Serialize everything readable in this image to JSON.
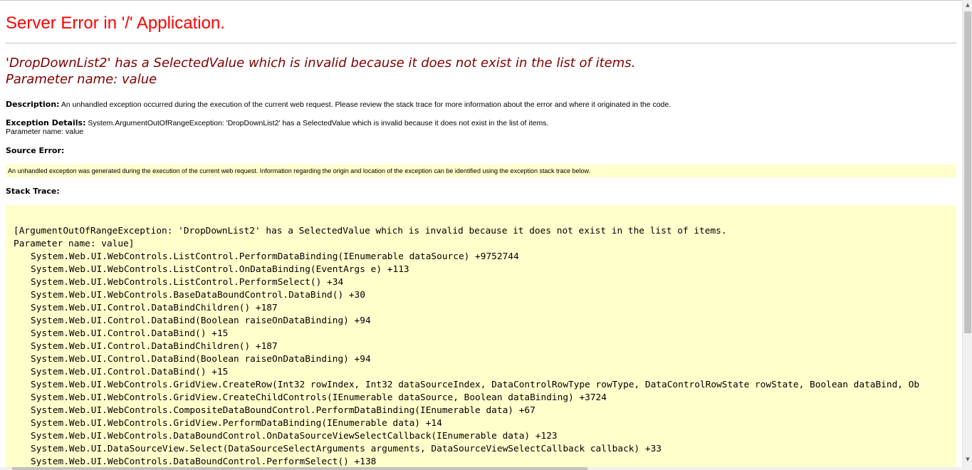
{
  "page": {
    "title": "Server Error in '/' Application.",
    "headline": [
      "'DropDownList2' has a SelectedValue which is invalid because it does not exist in the list of items.",
      "Parameter name: value"
    ],
    "description": {
      "label": "Description:",
      "text": "An unhandled exception occurred during the execution of the current web request. Please review the stack trace for more information about the error and where it originated in the code."
    },
    "exception_details": {
      "label": "Exception Details:",
      "text": "System.ArgumentOutOfRangeException: 'DropDownList2' has a SelectedValue which is invalid because it does not exist in the list of items.",
      "text2": "Parameter name: value"
    },
    "source_error": {
      "label": "Source Error:",
      "text": "An unhandled exception was generated during the execution of the current web request. Information regarding the origin and location of the exception can be identified using the exception stack trace below."
    },
    "stack_trace": {
      "label": "Stack Trace:",
      "header": [
        "[ArgumentOutOfRangeException: 'DropDownList2' has a SelectedValue which is invalid because it does not exist in the list of items.",
        "Parameter name: value]"
      ],
      "frames": [
        "System.Web.UI.WebControls.ListControl.PerformDataBinding(IEnumerable dataSource) +9752744",
        "System.Web.UI.WebControls.ListControl.OnDataBinding(EventArgs e) +113",
        "System.Web.UI.WebControls.ListControl.PerformSelect() +34",
        "System.Web.UI.WebControls.BaseDataBoundControl.DataBind() +30",
        "System.Web.UI.Control.DataBindChildren() +187",
        "System.Web.UI.Control.DataBind(Boolean raiseOnDataBinding) +94",
        "System.Web.UI.Control.DataBind() +15",
        "System.Web.UI.Control.DataBindChildren() +187",
        "System.Web.UI.Control.DataBind(Boolean raiseOnDataBinding) +94",
        "System.Web.UI.Control.DataBind() +15",
        "System.Web.UI.WebControls.GridView.CreateRow(Int32 rowIndex, Int32 dataSourceIndex, DataControlRowType rowType, DataControlRowState rowState, Boolean dataBind, Ob",
        "System.Web.UI.WebControls.GridView.CreateChildControls(IEnumerable dataSource, Boolean dataBinding) +3724",
        "System.Web.UI.WebControls.CompositeDataBoundControl.PerformDataBinding(IEnumerable data) +67",
        "System.Web.UI.WebControls.GridView.PerformDataBinding(IEnumerable data) +14",
        "System.Web.UI.WebControls.DataBoundControl.OnDataSourceViewSelectCallback(IEnumerable data) +123",
        "System.Web.UI.DataSourceView.Select(DataSourceSelectArguments arguments, DataSourceViewSelectCallback callback) +33",
        "System.Web.UI.WebControls.DataBoundControl.PerformSelect() +138"
      ]
    }
  },
  "scrollbar": {
    "up_icon": "arrow-up-icon",
    "down_icon": "arrow-down-icon"
  },
  "colors": {
    "title": "#ff0000",
    "headline": "#800000",
    "highlight_background": "#ffffcc"
  }
}
